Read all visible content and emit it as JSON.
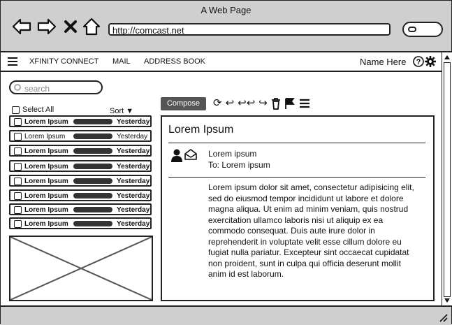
{
  "browser": {
    "title": "A Web Page",
    "url": "http://comcast.net"
  },
  "nav": {
    "items": [
      "XFINITY CONNECT",
      "MAIL",
      "ADDRESS BOOK"
    ],
    "username": "Name Here"
  },
  "sidebar": {
    "search_placeholder": "search",
    "select_all": "Select All",
    "sort": "Sort",
    "emails": [
      {
        "sender": "Lorem Ipsum",
        "date": "Yesterday",
        "bold": true
      },
      {
        "sender": "Lorem Ipsum",
        "date": "Yesterday",
        "bold": false
      },
      {
        "sender": "Lorem Ipsum",
        "date": "Yesterday",
        "bold": true
      },
      {
        "sender": "Lorem Ipsum",
        "date": "Yesterday",
        "bold": true
      },
      {
        "sender": "Lorem Ipsum",
        "date": "Yesterday",
        "bold": true
      },
      {
        "sender": "Lorem Ipsum",
        "date": "Yesterday",
        "bold": true
      },
      {
        "sender": "Lorem Ipsum",
        "date": "Yesterday",
        "bold": true
      },
      {
        "sender": "Lorem Ipsum",
        "date": "Yesterday",
        "bold": true
      }
    ]
  },
  "toolbar": {
    "compose_label": "Compose",
    "icons": [
      "refresh-icon",
      "reply-icon",
      "reply-all-icon",
      "forward-icon",
      "trash-icon",
      "flag-icon",
      "menu-icon"
    ]
  },
  "message": {
    "subject": "Lorem Ipsum",
    "from": "Lorem ipsum",
    "to": "To: Lorem ipsum",
    "body": "Lorem ipsum dolor sit amet, consectetur adipisicing elit, sed do eiusmod tempor incididunt ut labore et dolore magna aliqua. Ut enim ad minim veniam, quis nostrud exercitation ullamco laboris nisi ut aliquip ex ea commodo consequat. Duis aute irure dolor in reprehenderit in voluptate velit esse cillum dolore eu fugiat nulla pariatur. Excepteur sint occaecat cupidatat non proident, sunt in culpa qui officia deserunt mollit anim id est laborum."
  }
}
